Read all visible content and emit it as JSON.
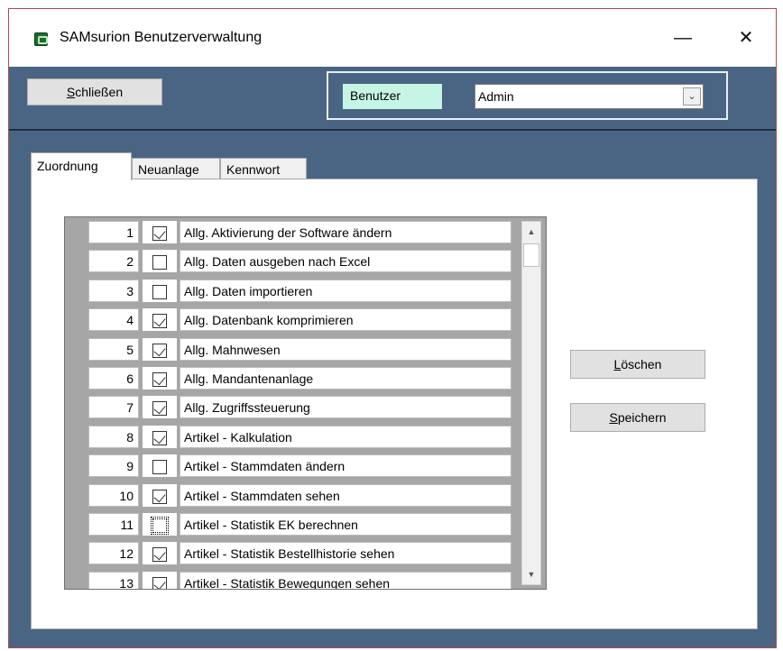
{
  "window": {
    "title": "SAMsurion Benutzerverwaltung",
    "minimize_glyph": "—",
    "close_glyph": "✕"
  },
  "toolbar": {
    "close_label_first": "S",
    "close_label_rest": "chließen"
  },
  "user": {
    "label": "Benutzer",
    "selected": "Admin"
  },
  "tabs": [
    {
      "label": "Zuordnung",
      "active": true
    },
    {
      "label": "Neuanlage",
      "active": false
    },
    {
      "label": "Kennwort",
      "active": false
    }
  ],
  "permissions": [
    {
      "num": "1",
      "checked": true,
      "label": "Allg. Aktivierung der Software ändern"
    },
    {
      "num": "2",
      "checked": false,
      "label": "Allg. Daten ausgeben nach Excel"
    },
    {
      "num": "3",
      "checked": false,
      "label": "Allg. Daten importieren"
    },
    {
      "num": "4",
      "checked": true,
      "label": "Allg. Datenbank komprimieren"
    },
    {
      "num": "5",
      "checked": true,
      "label": "Allg. Mahnwesen"
    },
    {
      "num": "6",
      "checked": true,
      "label": "Allg. Mandantenanlage"
    },
    {
      "num": "7",
      "checked": true,
      "label": "Allg. Zugriffssteuerung"
    },
    {
      "num": "8",
      "checked": true,
      "label": "Artikel - Kalkulation"
    },
    {
      "num": "9",
      "checked": false,
      "label": "Artikel - Stammdaten ändern"
    },
    {
      "num": "10",
      "checked": true,
      "label": "Artikel - Stammdaten sehen"
    },
    {
      "num": "11",
      "checked": false,
      "focused": true,
      "label": "Artikel - Statistik EK berechnen"
    },
    {
      "num": "12",
      "checked": true,
      "label": "Artikel - Statistik Bestellhistorie sehen"
    },
    {
      "num": "13",
      "checked": true,
      "label": "Artikel - Statistik Bewegungen sehen"
    }
  ],
  "actions": {
    "delete_first": "L",
    "delete_rest": "öschen",
    "save_first": "S",
    "save_rest": "peichern"
  },
  "icons": {
    "app": "samsurion-app-icon",
    "scroll_up": "▲",
    "scroll_down": "▼",
    "dropdown": "chevron-down-icon"
  }
}
